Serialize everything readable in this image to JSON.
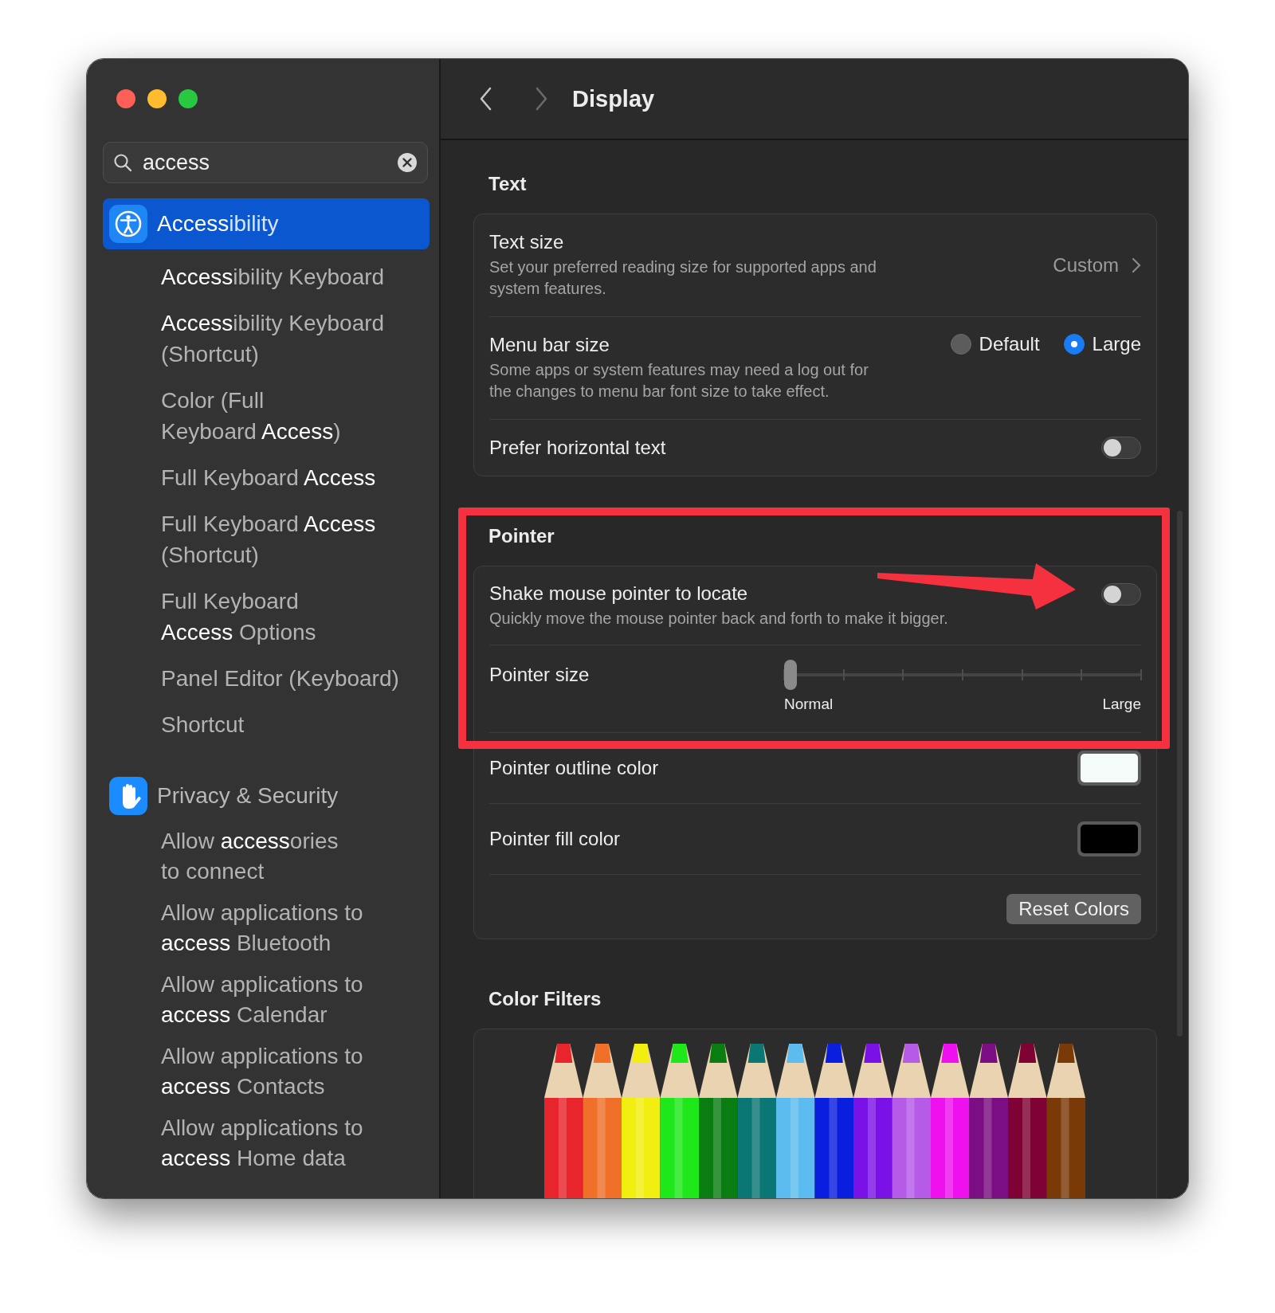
{
  "sidebar": {
    "search": {
      "value": "access"
    },
    "groups": [
      {
        "label": "**Access**ibility",
        "kind": "accessibility",
        "selected": true,
        "children": [
          {
            "label": "**Access**ibility Keyboard",
            "selected": false
          },
          {
            "label": "**Access**ibility Keyboard\n(Shortcut)",
            "selected": false
          },
          {
            "label": "Color (Full\nKeyboard **Access**)",
            "selected": false
          },
          {
            "label": "Full Keyboard **Access**",
            "selected": false
          },
          {
            "label": "Full Keyboard **Access**\n(Shortcut)",
            "selected": false
          },
          {
            "label": "Full Keyboard\n**Access** Options",
            "selected": false
          },
          {
            "label": "Panel Editor (Keyboard)",
            "selected": false
          },
          {
            "label": "Shortcut",
            "selected": false
          }
        ]
      },
      {
        "label": "Privacy & Security",
        "kind": "privacy",
        "selected": false,
        "children": [
          {
            "label": "Allow **access**ories\nto connect",
            "selected": false
          },
          {
            "label": "Allow applications to\n**access** Bluetooth",
            "selected": false
          },
          {
            "label": "Allow applications to\n**access** Calendar",
            "selected": false
          },
          {
            "label": "Allow applications to\n**access** Contacts",
            "selected": false
          },
          {
            "label": "Allow applications to\n**access** Home data",
            "selected": false
          }
        ]
      }
    ]
  },
  "toolbar": {
    "title": "Display",
    "back": {
      "disabled": false
    },
    "forward": {
      "disabled": true
    }
  },
  "sections": [
    {
      "title": "Text",
      "rows": [
        {
          "kind": "link",
          "label": "Text size",
          "description": "Set your preferred reading size for supported apps and\nsystem features.",
          "value": "Custom"
        },
        {
          "kind": "radio",
          "label": "Menu bar size",
          "description": "Some apps or system features may need a log out for\nthe changes to menu bar font size to take effect.",
          "options": [
            {
              "label": "Default",
              "selected": false
            },
            {
              "label": "Large",
              "selected": true
            }
          ]
        },
        {
          "kind": "toggle",
          "label": "Prefer horizontal text",
          "on": false
        }
      ]
    },
    {
      "title": "Pointer",
      "rows": [
        {
          "kind": "toggle",
          "label": "Shake mouse pointer to locate",
          "description": "Quickly move the mouse pointer back and forth to make it bigger.",
          "on": false
        },
        {
          "kind": "slider",
          "label": "Pointer size",
          "level": 0,
          "min_label": "Normal",
          "max_label": "Large"
        },
        {
          "kind": "color",
          "label": "Pointer outline color",
          "color": "#f4fbf8"
        },
        {
          "kind": "color",
          "label": "Pointer fill color",
          "color": "#000000"
        },
        {
          "kind": "button",
          "label": "Reset Colors"
        }
      ]
    },
    {
      "title": "Color Filters",
      "rows": [
        {
          "kind": "pencils"
        }
      ]
    }
  ],
  "annotation": {
    "highlight_box": true,
    "arrow": true
  }
}
